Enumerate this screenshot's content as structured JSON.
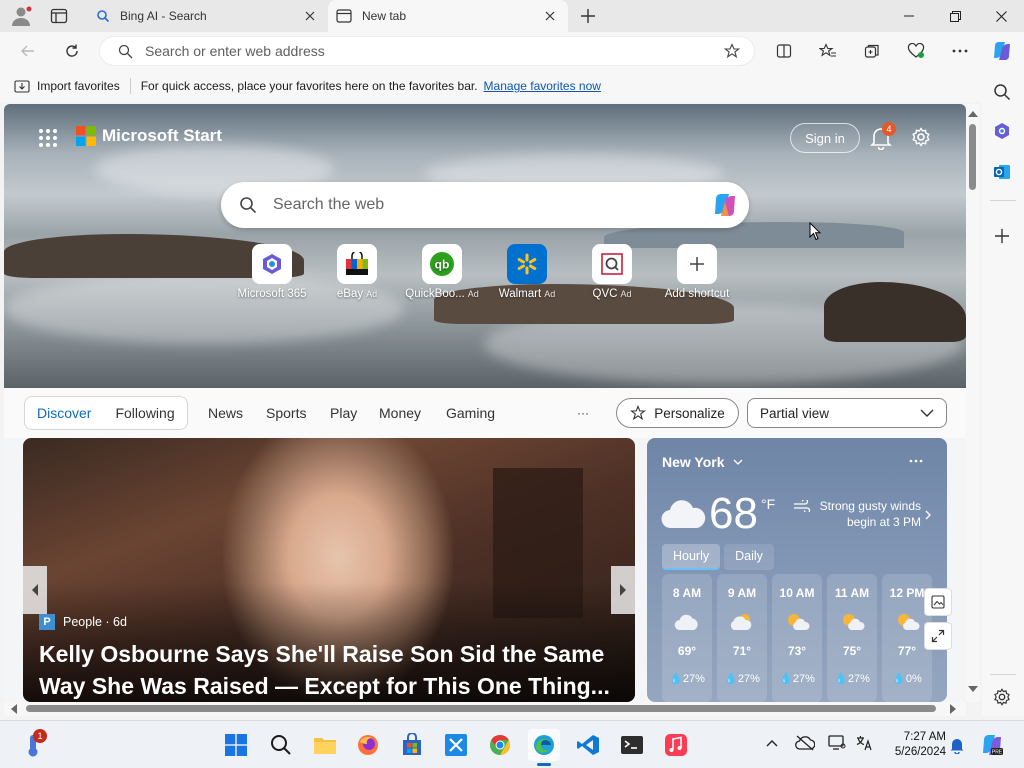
{
  "browser": {
    "tabs": [
      {
        "title": "Bing AI - Search"
      },
      {
        "title": "New tab"
      }
    ],
    "address_placeholder": "Search or enter web address"
  },
  "favorites_bar": {
    "import_label": "Import favorites",
    "message": "For quick access, place your favorites here on the favorites bar.",
    "manage_link": "Manage favorites now"
  },
  "page": {
    "brand": "Microsoft Start",
    "sign_in": "Sign in",
    "notification_count": "4",
    "search_placeholder": "Search the web",
    "shortcuts": [
      {
        "label": "Microsoft 365",
        "ad": "",
        "icon": "microsoft-365-icon"
      },
      {
        "label": "eBay",
        "ad": "Ad",
        "icon": "ebay-bag-icon"
      },
      {
        "label": "QuickBoo...",
        "ad": "Ad",
        "icon": "quickbooks-icon"
      },
      {
        "label": "Walmart",
        "ad": "Ad",
        "icon": "walmart-spark-icon"
      },
      {
        "label": "QVC",
        "ad": "Ad",
        "icon": "qvc-icon"
      },
      {
        "label": "Add shortcut",
        "ad": "",
        "icon": "plus-icon"
      }
    ],
    "feed_tabs": {
      "discover": "Discover",
      "following": "Following"
    },
    "nav": [
      "News",
      "Sports",
      "Play",
      "Money",
      "Gaming"
    ],
    "more": "···",
    "personalize": "Personalize",
    "view_select": "Partial view",
    "article": {
      "source": "People · 6d",
      "headline": "Kelly Osbourne Says She'll Raise Son Sid the Same Way She Was Raised — Except for This One Thing..."
    },
    "weather": {
      "location": "New York",
      "temp": "68",
      "unit": "°F",
      "alert": "Strong gusty winds begin at 3 PM",
      "tabs": [
        "Hourly",
        "Daily"
      ],
      "hours": [
        {
          "time": "8 AM",
          "temp": "69°",
          "precip": "27%",
          "icon": "cloud-icon"
        },
        {
          "time": "9 AM",
          "temp": "71°",
          "precip": "27%",
          "icon": "partly-cloudy-icon"
        },
        {
          "time": "10 AM",
          "temp": "73°",
          "precip": "27%",
          "icon": "partly-sunny-icon"
        },
        {
          "time": "11 AM",
          "temp": "75°",
          "precip": "27%",
          "icon": "partly-sunny-icon"
        },
        {
          "time": "12 PM",
          "temp": "77°",
          "precip": "0%",
          "icon": "partly-sunny-icon"
        }
      ]
    }
  },
  "taskbar": {
    "time": "7:27 AM",
    "date": "5/26/2024",
    "notification_badge": "1"
  },
  "colors": {
    "accent": "#0f6cbd",
    "link": "#0f55b5",
    "weather_bg": "#7f94b3"
  }
}
